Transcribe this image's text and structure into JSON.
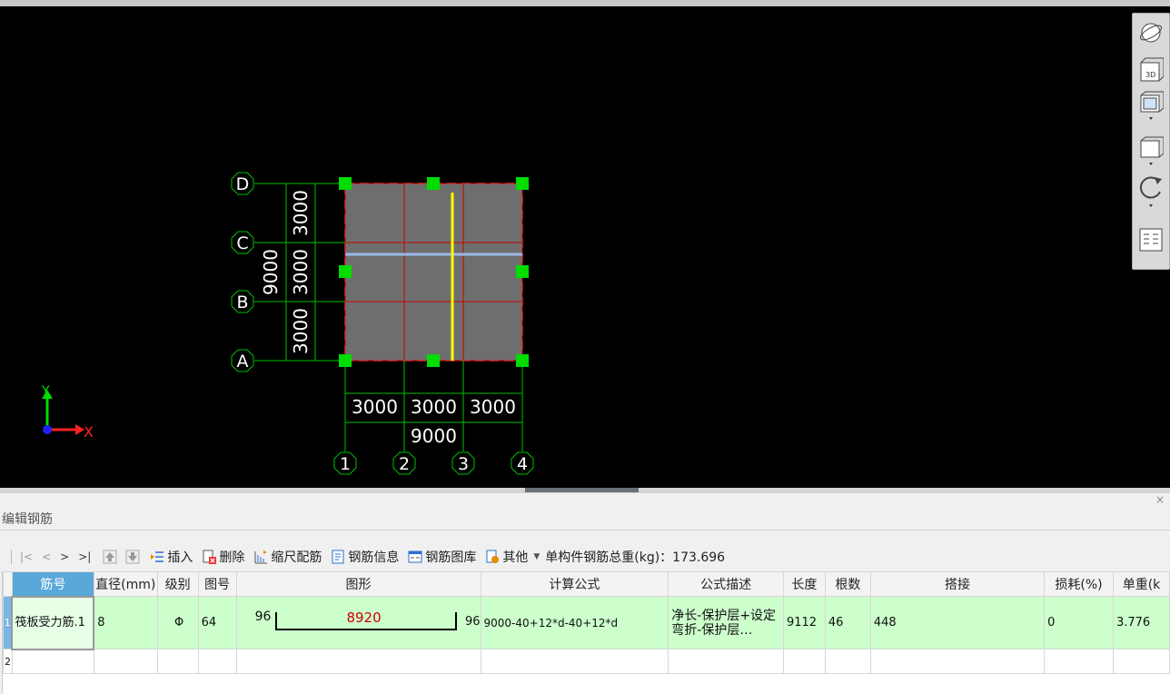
{
  "viewport": {
    "axis_labels": {
      "y": "Y",
      "x": "X"
    },
    "rows": [
      "D",
      "C",
      "B",
      "A"
    ],
    "row_spacings": [
      "3000",
      "3000",
      "3000"
    ],
    "row_total": "9000",
    "columns": [
      "1",
      "2",
      "3",
      "4"
    ],
    "col_spacings": [
      "3000",
      "3000",
      "3000"
    ],
    "col_total": "9000",
    "colors": {
      "background": "#000000",
      "slab": "#6e6e6e",
      "axis_line": "#00c000",
      "beam": "#cc0000",
      "highlight": "#ffff00",
      "selected_bar": "#9cb8e8",
      "handle": "#00dd00"
    }
  },
  "view_toolbar": {
    "icons": [
      "dynamic-orbit-icon",
      "3d-view-icon",
      "view-box-icon",
      "view-cube-icon",
      "rotate-icon",
      "layout-icon"
    ],
    "label_3d": "3D"
  },
  "panel": {
    "title": "编辑钢筋",
    "close": "×",
    "toolbar": {
      "nav": [
        "|<",
        "<",
        ">",
        ">|"
      ],
      "insert": "插入",
      "delete": "删除",
      "scale_config": "缩尺配筋",
      "rebar_info": "钢筋信息",
      "rebar_library": "钢筋图库",
      "other": "其他",
      "total_weight": "单构件钢筋总重(kg)：173.696"
    },
    "table": {
      "headers": [
        "筋号",
        "直径(mm)",
        "级别",
        "图号",
        "图形",
        "计算公式",
        "公式描述",
        "长度",
        "根数",
        "搭接",
        "损耗(%)",
        "单重(k"
      ],
      "rows": [
        {
          "no": "1",
          "name": "筏板受力筋.1",
          "diameter": "8",
          "grade": "Φ",
          "fig_no": "64",
          "shape_left": "96",
          "shape_mid": "8920",
          "shape_right": "96",
          "formula": "9000-40+12*d-40+12*d",
          "desc": "净长-保护层+设定弯折-保护层…",
          "length": "9112",
          "count": "46",
          "lap": "448",
          "loss": "0",
          "unit_weight": "3.776"
        }
      ],
      "empty_row_no": "2"
    }
  }
}
